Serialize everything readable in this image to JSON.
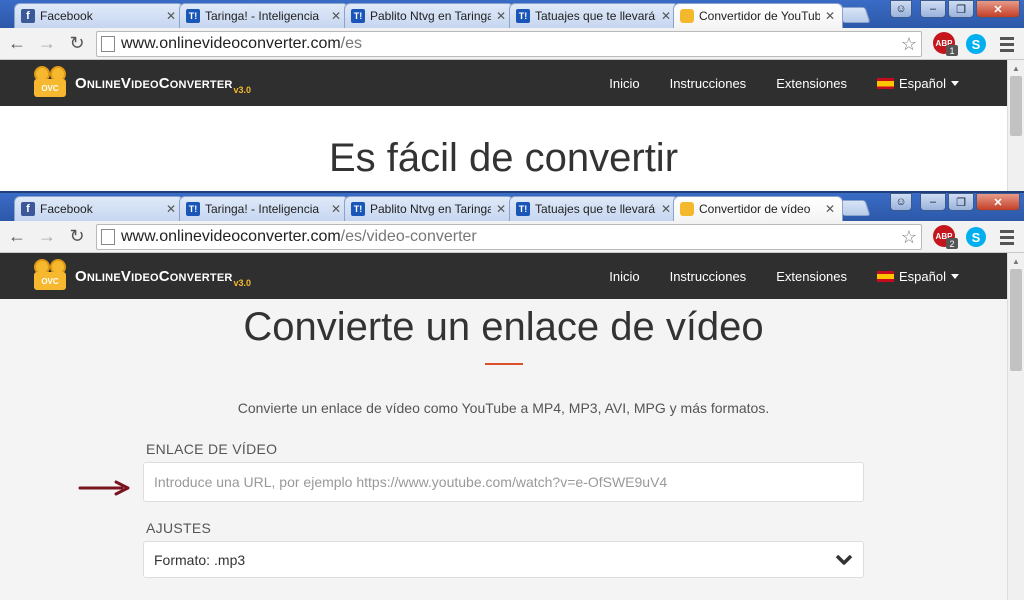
{
  "browser_top": {
    "tabs": [
      {
        "label": "Facebook",
        "favicon": "facebook-icon"
      },
      {
        "label": "Taringa! - Inteligencia",
        "favicon": "taringa-icon"
      },
      {
        "label": "Pablito Ntvg en Taringa",
        "favicon": "taringa-icon"
      },
      {
        "label": "Tatuajes que te llevarán",
        "favicon": "taringa-icon"
      },
      {
        "label": "Convertidor de YouTube",
        "favicon": "ovc-icon",
        "active": true
      }
    ],
    "url_host": "www.onlinevideoconverter.com",
    "url_path": "/es",
    "abp_count": "1"
  },
  "browser_bottom": {
    "tabs": [
      {
        "label": "Facebook",
        "favicon": "facebook-icon"
      },
      {
        "label": "Taringa! - Inteligencia",
        "favicon": "taringa-icon"
      },
      {
        "label": "Pablito Ntvg en Taringa",
        "favicon": "taringa-icon"
      },
      {
        "label": "Tatuajes que te llevarán",
        "favicon": "taringa-icon"
      },
      {
        "label": "Convertidor de vídeo",
        "favicon": "ovc-icon",
        "active": true
      }
    ],
    "url_host": "www.onlinevideoconverter.com",
    "url_path": "/es/video-converter",
    "abp_count": "2"
  },
  "extensions": {
    "abp_label": "ABP",
    "skype_label": "S"
  },
  "site": {
    "logo_badge": "OVC",
    "logo_name": "OnlineVideoConverter",
    "logo_version": "v3.0",
    "nav": [
      "Inicio",
      "Instrucciones",
      "Extensiones"
    ],
    "language": "Español"
  },
  "top_page": {
    "heading": "Es fácil de convertir"
  },
  "converter": {
    "heading": "Convierte un enlace de vídeo",
    "lead": "Convierte un enlace de vídeo como YouTube a MP4, MP3, AVI, MPG y más formatos.",
    "link_label": "ENLACE DE VÍDEO",
    "link_placeholder": "Introduce una URL, por ejemplo https://www.youtube.com/watch?v=e-OfSWE9uV4",
    "settings_label": "AJUSTES",
    "format_prefix": "Formato:",
    "format_value": ".mp3"
  },
  "colors": {
    "accent": "#d9502a",
    "nav_bg": "#2f2f2f",
    "logo": "#f5b82e",
    "pointer_arrow": "#7a1320"
  },
  "icons": {
    "back": "←",
    "forward": "→",
    "reload": "↻",
    "star": "☆",
    "close": "✕"
  },
  "scroll": {
    "top_window_thumb_position": 0.0,
    "bottom_window_thumb_position": 0.0
  }
}
